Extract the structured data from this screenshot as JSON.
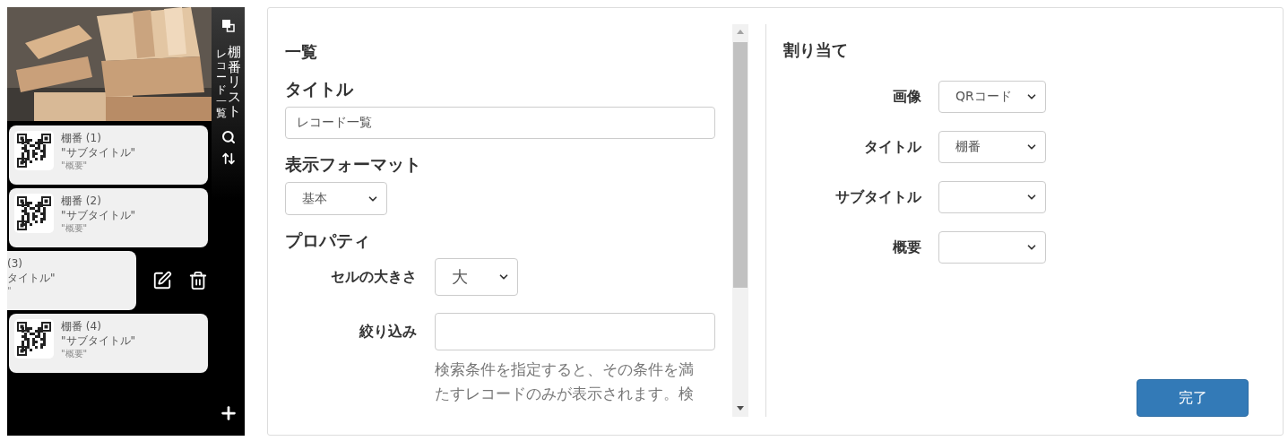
{
  "sidebar": {
    "title": "棚番リスト",
    "subtitle": "レコード一覧",
    "cards": [
      {
        "title": "棚番 (1)",
        "subtitle": "\"サブタイトル\"",
        "summary": "\"概要\"",
        "swiped": false
      },
      {
        "title": "棚番 (2)",
        "subtitle": "\"サブタイトル\"",
        "summary": "\"概要\"",
        "swiped": false
      },
      {
        "title": "(3)",
        "subtitle": "タイトル\"",
        "summary": "\"",
        "swiped": true
      },
      {
        "title": "棚番 (4)",
        "subtitle": "\"サブタイトル\"",
        "summary": "\"概要\"",
        "swiped": false
      }
    ]
  },
  "list_settings": {
    "heading": "一覧",
    "title_label": "タイトル",
    "title_value": "レコード一覧",
    "format_label": "表示フォーマット",
    "format_value": "基本",
    "properties_heading": "プロパティ",
    "properties": [
      {
        "kind": "select",
        "label": "セルの大きさ",
        "value": "大"
      },
      {
        "kind": "input",
        "label": "絞り込み",
        "help": "検索条件を指定すると、その条件を満たすレコードのみが表示されます。検"
      }
    ]
  },
  "assignment": {
    "heading": "割り当て",
    "fields": [
      {
        "label": "画像",
        "value": "QRコード"
      },
      {
        "label": "タイトル",
        "value": "棚番"
      },
      {
        "label": "サブタイトル"
      },
      {
        "label": "概要"
      }
    ]
  },
  "done_button": "完了"
}
